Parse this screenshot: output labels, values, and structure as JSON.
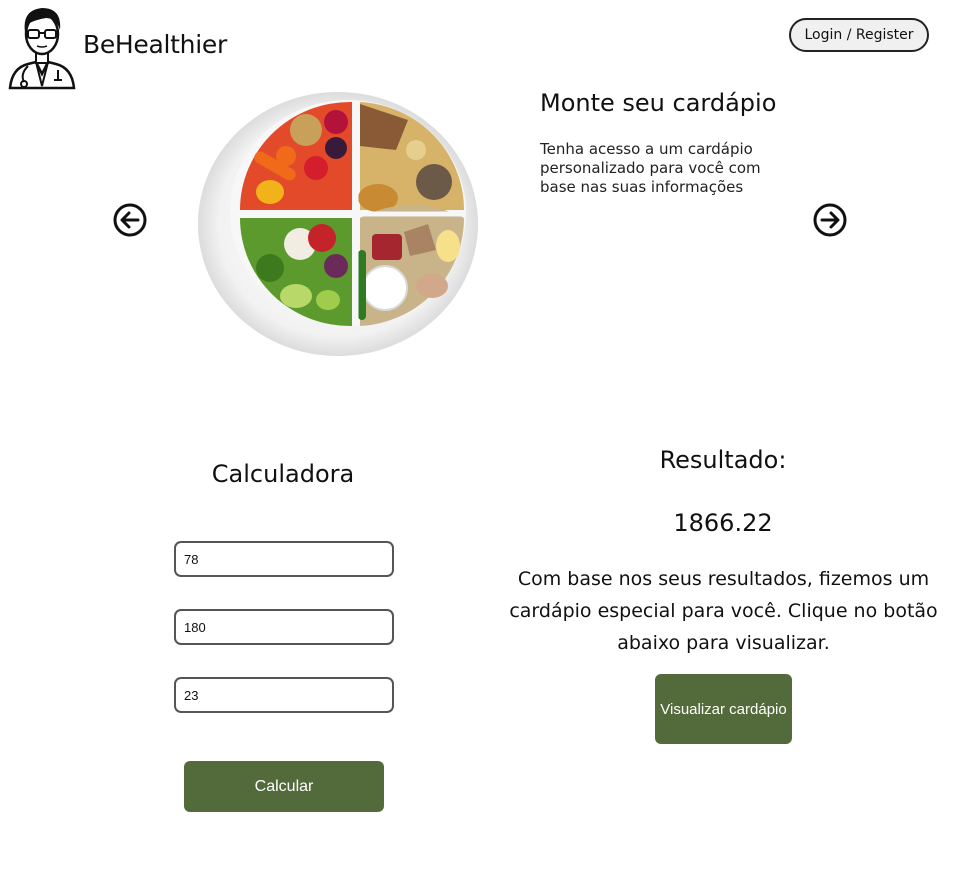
{
  "header": {
    "brand": "BeHealthier",
    "login_label": "Login / Register",
    "logo_icon": "doctor-avatar-icon"
  },
  "carousel": {
    "title": "Monte seu cardápio",
    "description": "Tenha acesso a um cardápio personalizado para você com base nas suas informações",
    "prev_icon": "arrow-left-circle-icon",
    "next_icon": "arrow-right-circle-icon"
  },
  "calculator": {
    "title": "Calculadora",
    "fields": [
      {
        "value": "78"
      },
      {
        "value": "180"
      },
      {
        "value": "23"
      }
    ],
    "button_label": "Calcular"
  },
  "result": {
    "title": "Resultado:",
    "value": "1866.22",
    "message": "Com base nos seus resultados, fizemos um cardápio especial para você. Clique no botão abaixo para visualizar.",
    "button_label": "Visualizar cardápio"
  },
  "colors": {
    "accent_green": "#536a3b",
    "text": "#111111",
    "background": "#ffffff"
  }
}
